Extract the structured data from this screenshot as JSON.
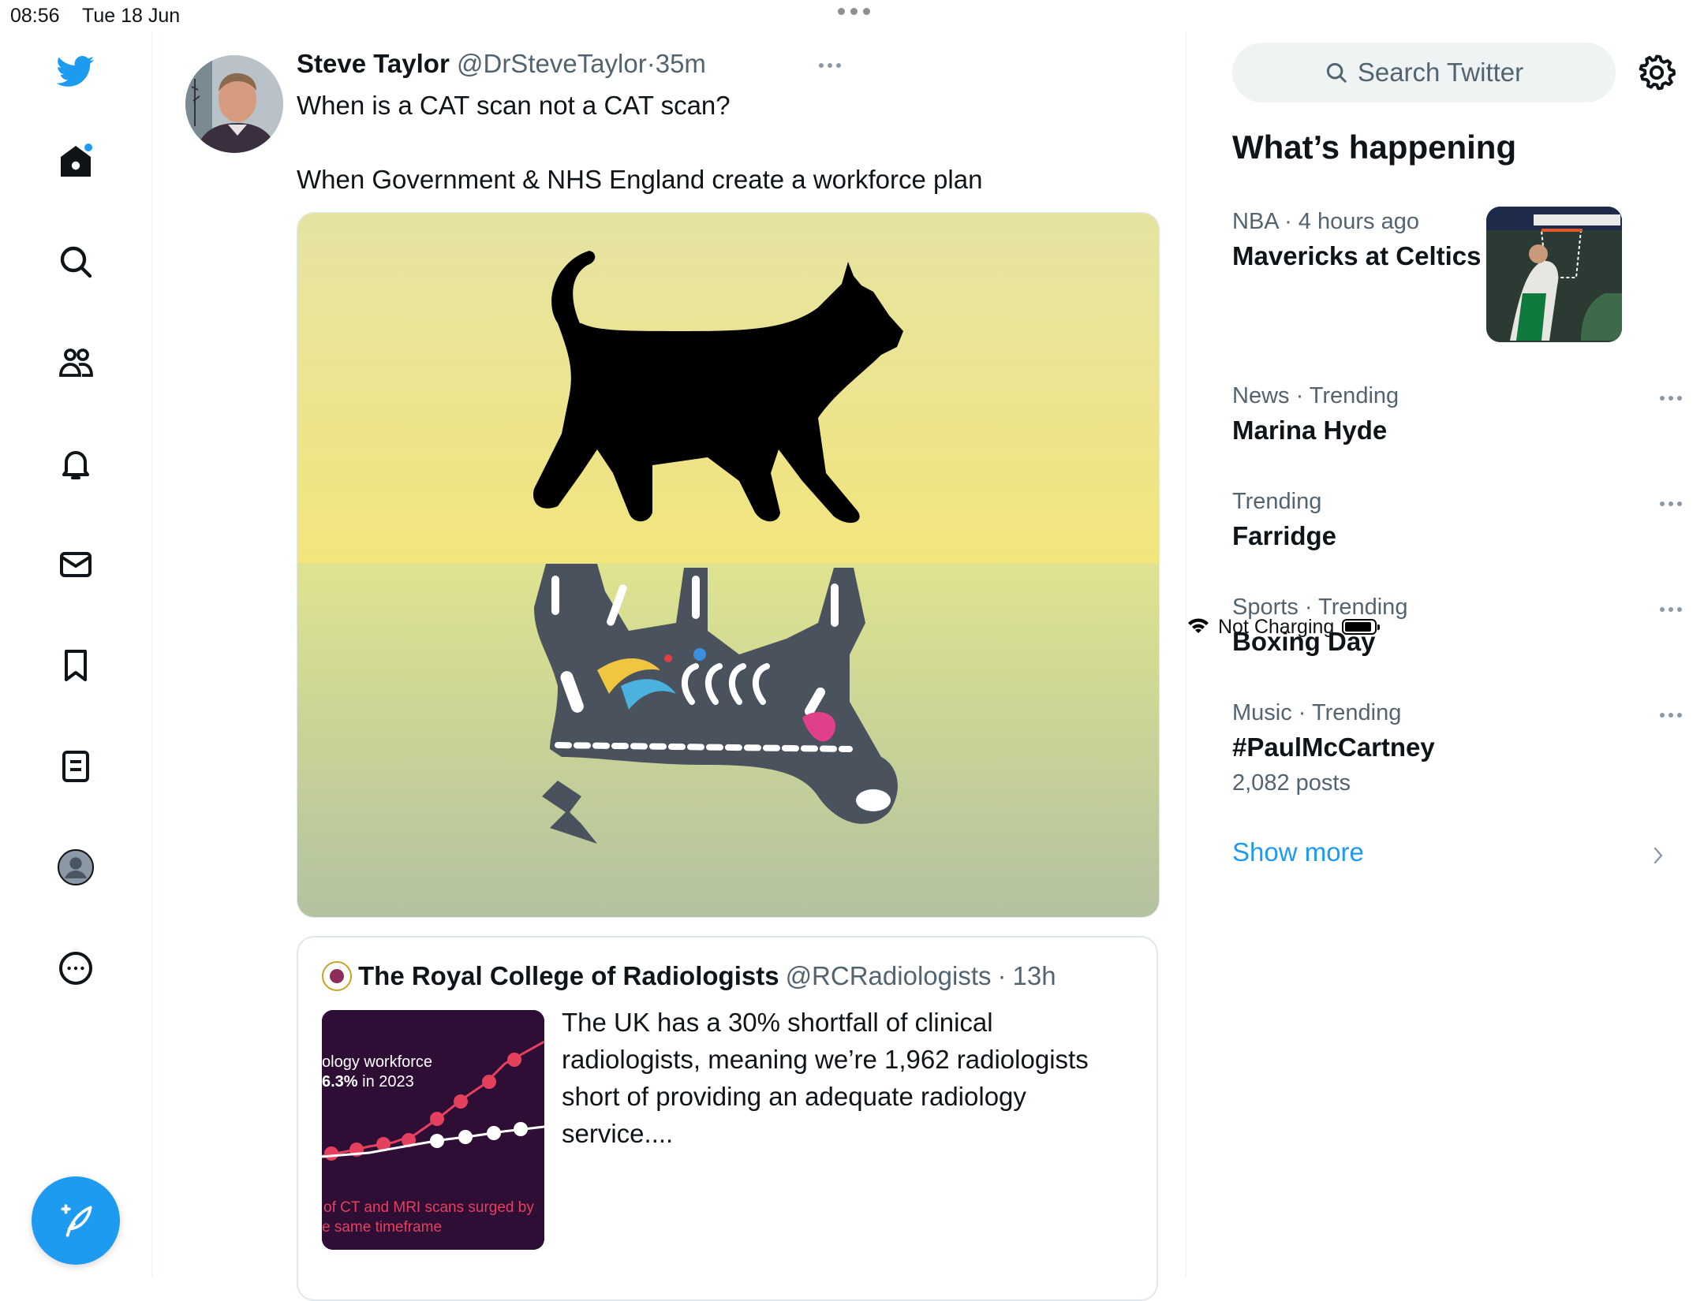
{
  "status_bar": {
    "time": "08:56",
    "date": "Tue 18 Jun",
    "battery_status": "Not Charging"
  },
  "sidebar": {
    "items": [
      {
        "icon": "twitter-bird-icon"
      },
      {
        "icon": "home-icon"
      },
      {
        "icon": "search-icon"
      },
      {
        "icon": "communities-icon"
      },
      {
        "icon": "bell-icon"
      },
      {
        "icon": "mail-icon"
      },
      {
        "icon": "bookmark-icon"
      },
      {
        "icon": "lists-icon"
      },
      {
        "icon": "profile-icon"
      },
      {
        "icon": "more-circle-icon"
      }
    ],
    "compose_icon": "compose-feather-icon"
  },
  "tweet": {
    "name": "Steve Taylor",
    "handle": "@DrSteveTaylor",
    "separator": "·",
    "time": "35m",
    "text": "When is a CAT scan not a CAT scan?\n\nWhen Government & NHS England create a workforce plan",
    "quote": {
      "name": "The Royal College of Radiologists",
      "handle": "@RCRadiologists",
      "separator": "·",
      "time": "13h",
      "text": "The UK has a 30% shortfall of clinical radiologists, meaning we’re 1,962 radiologists short of providing an adequate radiology service....",
      "thumb_line1": "ology workforce",
      "thumb_line2_bold": "6.3%",
      "thumb_line2_rest": " in 2023",
      "thumb_line3": "of CT and MRI scans surged by",
      "thumb_line4": "e same timeframe"
    }
  },
  "right_panel": {
    "search_placeholder": "Search Twitter",
    "heading": "What’s happening",
    "trends": [
      {
        "context": "NBA · 4 hours ago",
        "title": "Mavericks at Celtics",
        "count": ""
      },
      {
        "context": "News · Trending",
        "title": "Marina Hyde",
        "count": ""
      },
      {
        "context": "Trending",
        "title": "Farridge",
        "count": ""
      },
      {
        "context": "Sports · Trending",
        "title": "Boxing Day",
        "count": ""
      },
      {
        "context": "Music · Trending",
        "title": "#PaulMcCartney",
        "count": "2,082 posts"
      }
    ],
    "show_more": "Show more"
  },
  "colors": {
    "accent": "#1d9bf0",
    "text": "#0f1419",
    "muted": "#536471",
    "border": "#eff3f4"
  }
}
